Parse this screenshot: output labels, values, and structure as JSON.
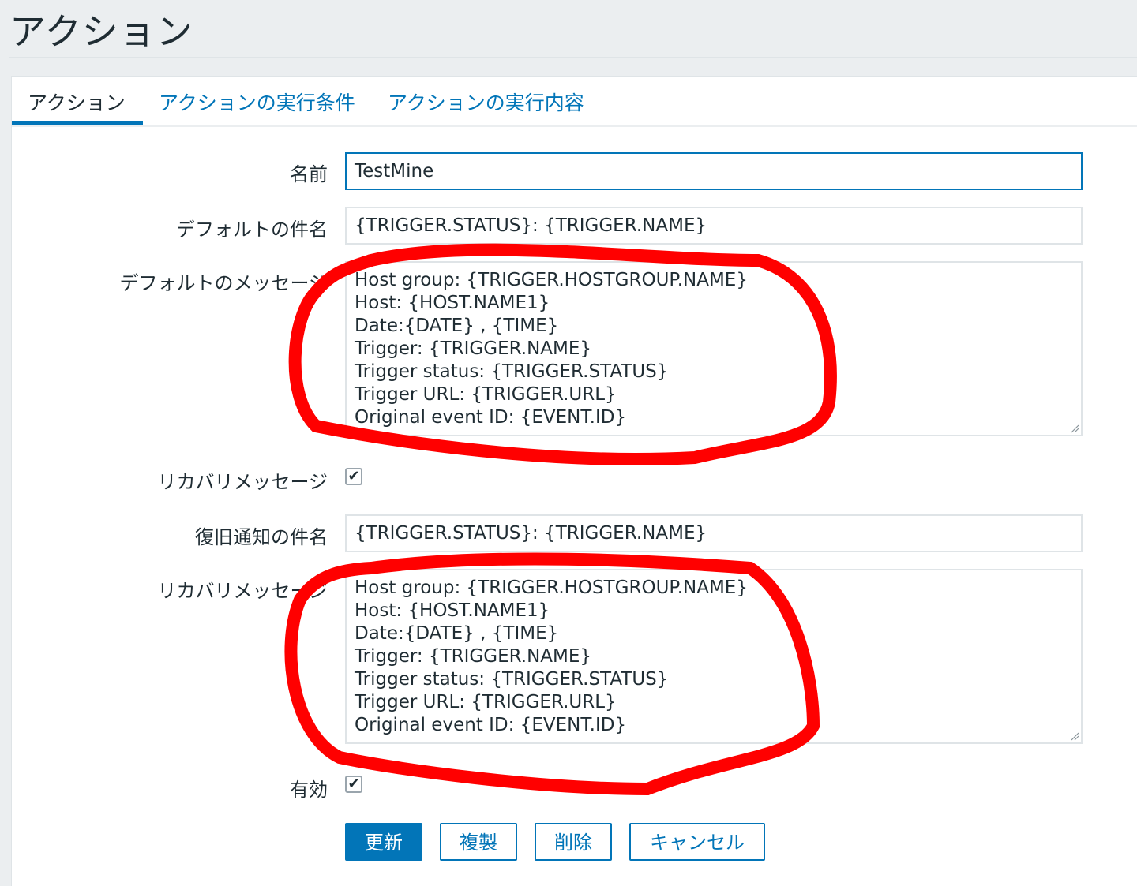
{
  "page": {
    "title": "アクション"
  },
  "tabs": [
    {
      "label": "アクション",
      "active": true
    },
    {
      "label": "アクションの実行条件",
      "active": false
    },
    {
      "label": "アクションの実行内容",
      "active": false
    }
  ],
  "form": {
    "name": {
      "label": "名前",
      "value": "TestMine"
    },
    "default_subject": {
      "label": "デフォルトの件名",
      "value": "{TRIGGER.STATUS}: {TRIGGER.NAME}"
    },
    "default_message": {
      "label": "デフォルトのメッセージ",
      "lines": [
        "Host group: {TRIGGER.HOSTGROUP.NAME}",
        "Host: {HOST.NAME1}",
        "Date:{DATE} , {TIME}",
        "Trigger: {TRIGGER.NAME}",
        "Trigger status: {TRIGGER.STATUS}",
        "Trigger URL: {TRIGGER.URL}",
        "Original event ID: {EVENT.ID}"
      ]
    },
    "recovery_message_enabled": {
      "label": "リカバリメッセージ",
      "checked": true
    },
    "recovery_subject": {
      "label": "復旧通知の件名",
      "value": "{TRIGGER.STATUS}: {TRIGGER.NAME}"
    },
    "recovery_message": {
      "label": "リカバリメッセージ",
      "lines": [
        "Host group: {TRIGGER.HOSTGROUP.NAME}",
        "Host: {HOST.NAME1}",
        "Date:{DATE} , {TIME}",
        "Trigger: {TRIGGER.NAME}",
        "Trigger status: {TRIGGER.STATUS}",
        "Trigger URL: {TRIGGER.URL}",
        "Original event ID: {EVENT.ID}"
      ]
    },
    "enabled": {
      "label": "有効",
      "checked": true
    }
  },
  "buttons": {
    "update": "更新",
    "clone": "複製",
    "delete": "削除",
    "cancel": "キャンセル"
  },
  "check_glyph": "✔",
  "colors": {
    "accent": "#0275b8",
    "annotation": "#ff0000",
    "background": "#ebeef0"
  },
  "icons": [
    "checkmark-icon",
    "resize-grip-icon"
  ]
}
